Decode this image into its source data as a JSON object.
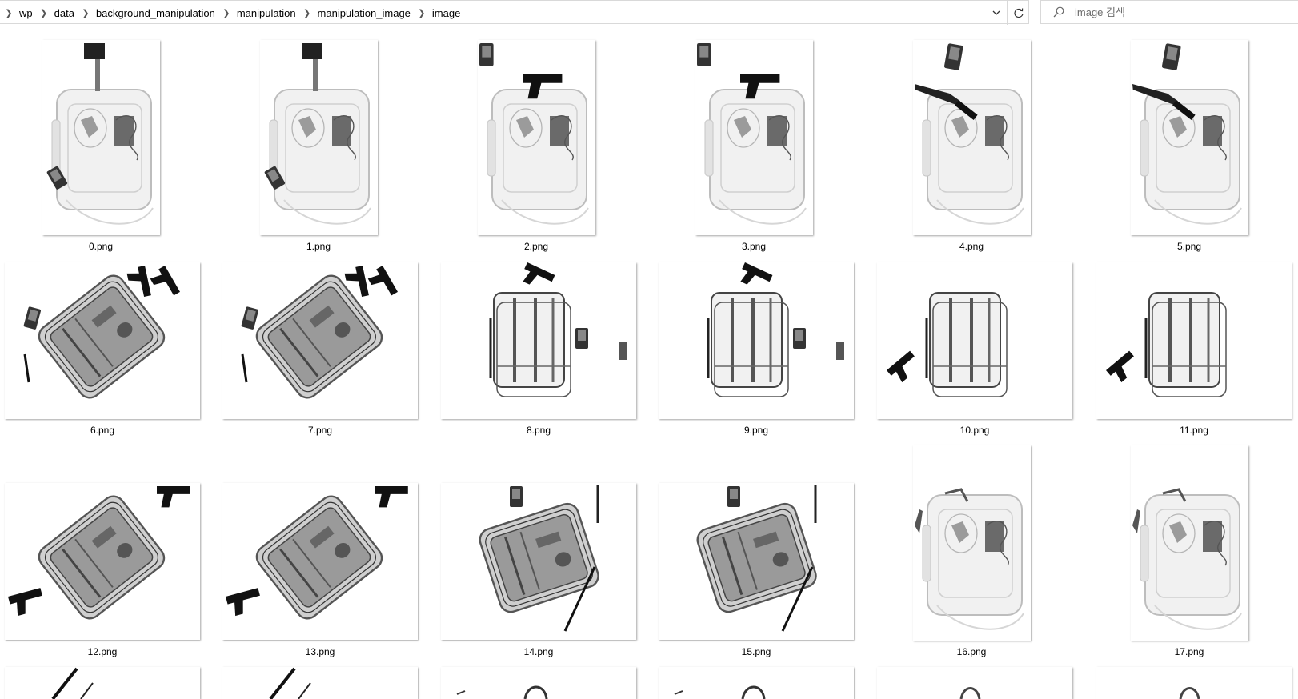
{
  "breadcrumb": [
    "wp",
    "data",
    "background_manipulation",
    "manipulation",
    "manipulation_image",
    "image"
  ],
  "search": {
    "placeholder": "image 검색"
  },
  "files": [
    {
      "name": "0.png"
    },
    {
      "name": "1.png"
    },
    {
      "name": "2.png"
    },
    {
      "name": "3.png"
    },
    {
      "name": "4.png"
    },
    {
      "name": "5.png"
    },
    {
      "name": "6.png"
    },
    {
      "name": "7.png"
    },
    {
      "name": "8.png"
    },
    {
      "name": "9.png"
    },
    {
      "name": "10.png"
    },
    {
      "name": "11.png"
    },
    {
      "name": "12.png"
    },
    {
      "name": "13.png"
    },
    {
      "name": "14.png"
    },
    {
      "name": "15.png"
    },
    {
      "name": "16.png"
    },
    {
      "name": "17.png"
    }
  ],
  "colors": {
    "border": "#d9d9d9",
    "text": "#000000",
    "muted": "#6d6d6d"
  },
  "icons": [
    "chevron-right-icon",
    "chevron-down-icon",
    "refresh-icon",
    "search-icon"
  ]
}
